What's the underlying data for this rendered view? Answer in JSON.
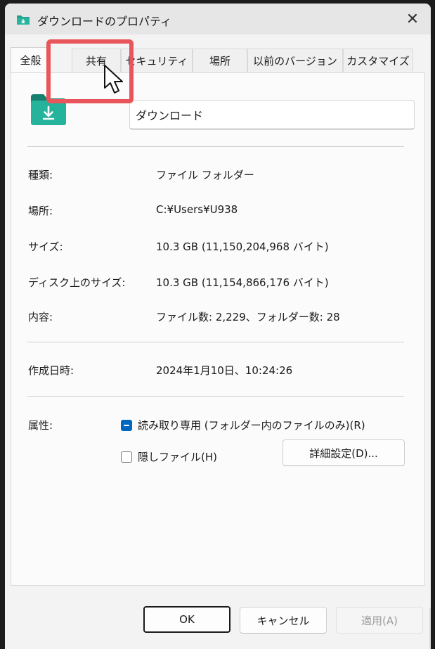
{
  "window": {
    "title": "ダウンロードのプロパティ",
    "close_label": "✕",
    "icon": "download-folder-icon"
  },
  "tabs": [
    {
      "label": "全般",
      "active": true
    },
    {
      "label": "共有",
      "active": false
    },
    {
      "label": "セキュリティ",
      "active": false
    },
    {
      "label": "場所",
      "active": false
    },
    {
      "label": "以前のバージョン",
      "active": false
    },
    {
      "label": "カスタマイズ",
      "active": false
    }
  ],
  "general": {
    "folder_name": "ダウンロード",
    "properties": [
      {
        "label": "種類:",
        "value": "ファイル フォルダー"
      },
      {
        "label": "場所:",
        "value": "C:¥Users¥U938"
      },
      {
        "label": "サイズ:",
        "value": "10.3 GB (11,150,204,968 バイト)"
      },
      {
        "label": "ディスク上のサイズ:",
        "value": "10.3 GB (11,154,866,176 バイト)"
      },
      {
        "label": "内容:",
        "value": "ファイル数: 2,229、フォルダー数: 28"
      }
    ],
    "created": {
      "label": "作成日時:",
      "value": "2024年1月10日、10:24:26"
    },
    "attributes": {
      "label": "属性:",
      "readonly_label": "読み取り専用 (フォルダー内のファイルのみ)(R)",
      "readonly_state": "indeterminate",
      "hidden_label": "隠しファイル(H)",
      "hidden_state": "unchecked",
      "advanced_button": "詳細設定(D)..."
    }
  },
  "footer": {
    "ok": "OK",
    "cancel": "キャンセル",
    "apply": "適用(A)"
  },
  "colors": {
    "accent": "#0067c0",
    "highlight": "#e8555a",
    "folder_green": "#1f9e8b"
  }
}
